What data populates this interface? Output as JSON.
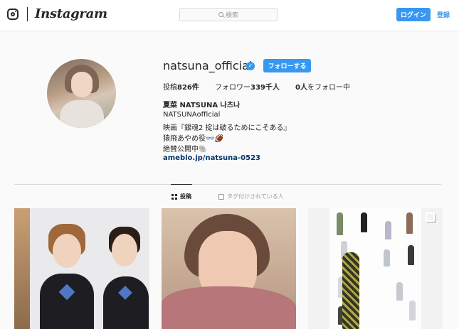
{
  "nav": {
    "brand": "Instagram",
    "search_placeholder": "検索",
    "login_label": "ログイン",
    "signup_label": "登録"
  },
  "profile": {
    "username": "natsuna_official",
    "follow_label": "フォローする",
    "stats": {
      "posts_prefix": "投稿",
      "posts_value": "826件",
      "followers_prefix": "フォロワー",
      "followers_value": "339千人",
      "following_value": "0人",
      "following_suffix": "をフォロー中"
    },
    "bio": {
      "name": "夏菜 NATSUNA 나츠나",
      "line1": "NATSUNAofficial",
      "line2": "映画『銀魂2 掟は破るためにこそある』",
      "line3": "猿飛あやめ役👓🏈",
      "line4": "絶賛公開中🐘",
      "link": "ameblo.jp/natsuna-0523"
    }
  },
  "tabs": {
    "posts_label": "投稿",
    "tagged_label": "タグ付けされている人"
  },
  "colors": {
    "accent": "#3897f0",
    "text": "#262626",
    "background": "#fafafa"
  }
}
